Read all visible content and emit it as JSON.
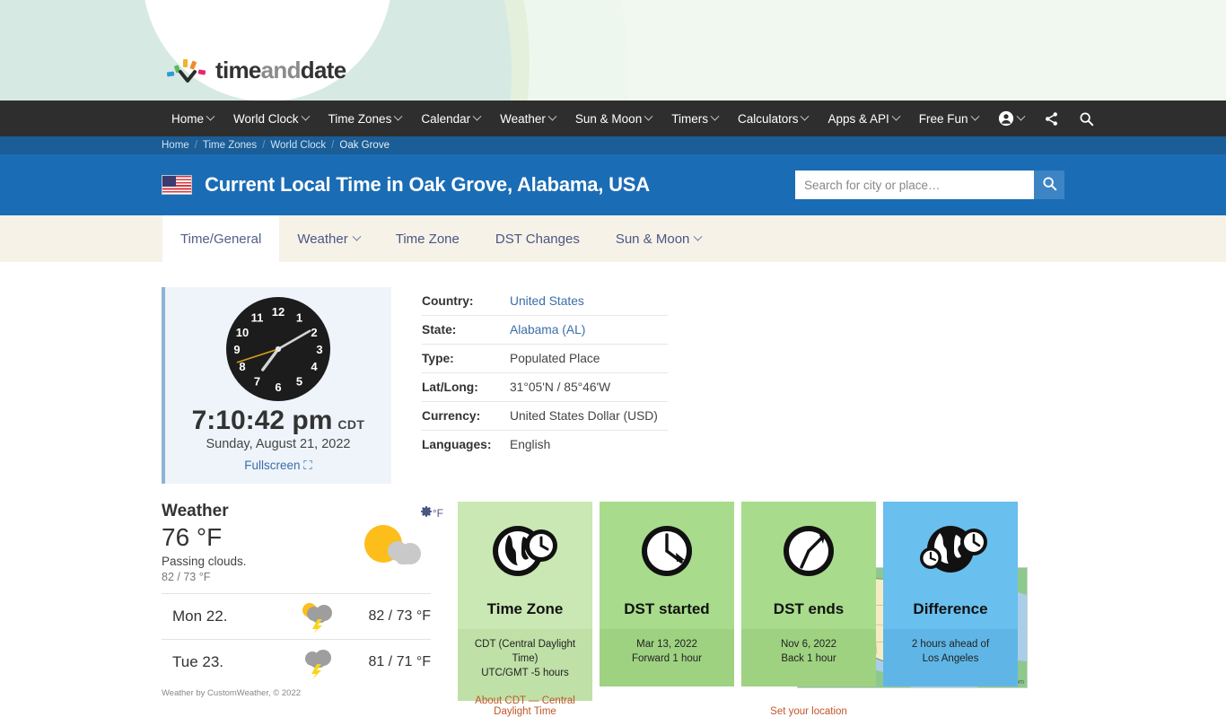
{
  "brand": {
    "name_part1": "time",
    "name_part2": "and",
    "name_part3": "date"
  },
  "nav": {
    "items": [
      {
        "label": "Home",
        "has_caret": true
      },
      {
        "label": "World Clock",
        "has_caret": true
      },
      {
        "label": "Time Zones",
        "has_caret": true
      },
      {
        "label": "Calendar",
        "has_caret": true
      },
      {
        "label": "Weather",
        "has_caret": true
      },
      {
        "label": "Sun & Moon",
        "has_caret": true
      },
      {
        "label": "Timers",
        "has_caret": true
      },
      {
        "label": "Calculators",
        "has_caret": true
      },
      {
        "label": "Apps & API",
        "has_caret": true
      },
      {
        "label": "Free Fun",
        "has_caret": true
      }
    ],
    "account_icon": "user-account-icon",
    "share_icon": "share-icon",
    "search_icon": "search-icon"
  },
  "breadcrumb": [
    "Home",
    "Time Zones",
    "World Clock",
    "Oak Grove"
  ],
  "header": {
    "flag_icon": "usa-flag-icon",
    "title": "Current Local Time in Oak Grove, Alabama, USA",
    "search_placeholder": "Search for city or place…",
    "search_value": "",
    "search_button_icon": "search-icon"
  },
  "tabs": [
    {
      "label": "Time/General",
      "active": true,
      "caret": false
    },
    {
      "label": "Weather",
      "active": false,
      "caret": true
    },
    {
      "label": "Time Zone",
      "active": false,
      "caret": false
    },
    {
      "label": "DST Changes",
      "active": false,
      "caret": false
    },
    {
      "label": "Sun & Moon",
      "active": false,
      "caret": true
    }
  ],
  "clock": {
    "time": "7:10:42 pm",
    "timezone_abbr": "CDT",
    "date": "Sunday, August 21, 2022",
    "fullscreen_label": "Fullscreen",
    "fullscreen_icon": "expand-icon",
    "hours": 7,
    "minutes": 10,
    "seconds": 42,
    "numerals": [
      "12",
      "1",
      "2",
      "3",
      "4",
      "5",
      "6",
      "7",
      "8",
      "9",
      "10",
      "11"
    ]
  },
  "info": {
    "rows": [
      {
        "key": "Country:",
        "value": "United States",
        "link": true
      },
      {
        "key": "State:",
        "value": "Alabama (AL)",
        "link": true
      },
      {
        "key": "Type:",
        "value": "Populated Place",
        "link": false
      },
      {
        "key": "Lat/Long:",
        "value": "31°05'N / 85°46'W",
        "link": false
      },
      {
        "key": "Currency:",
        "value": "United States Dollar (USD)",
        "link": false
      },
      {
        "key": "Languages:",
        "value": "English",
        "link": false
      }
    ]
  },
  "map": {
    "credit": "© timeanddate.com",
    "alt": "map-of-united-states"
  },
  "weather": {
    "title": "Weather",
    "temperature": "76 °F",
    "description": "Passing clouds.",
    "high_low": "82 / 73 °F",
    "unit_toggle": "°F",
    "gear_icon": "gear-icon",
    "current_icon": "sun-behind-cloud-icon",
    "forecast": [
      {
        "day": "Mon 22.",
        "icon": "sun-cloud-thunderstorm-icon",
        "temps": "82 / 73 °F"
      },
      {
        "day": "Tue 23.",
        "icon": "cloud-thunderstorm-icon",
        "temps": "81 / 71 °F"
      }
    ],
    "credit": "Weather by CustomWeather, © 2022"
  },
  "cards": [
    {
      "icon": "globe-clock-icon",
      "title": "Time Zone",
      "line1": "CDT (Central Daylight Time)",
      "line2": "UTC/GMT -5 hours",
      "link": "About CDT — Central Daylight Time",
      "theme": "c-green-light"
    },
    {
      "icon": "clock-forward-icon",
      "title": "DST started",
      "line1": "Mar 13, 2022",
      "line2": "Forward 1 hour",
      "link": "",
      "theme": "c-green"
    },
    {
      "icon": "clock-backward-icon",
      "title": "DST ends",
      "line1": "Nov 6, 2022",
      "line2": "Back 1 hour",
      "link": "Set your location",
      "theme": "c-green"
    },
    {
      "icon": "globe-clocks-difference-icon",
      "title": "Difference",
      "line1": "2 hours ahead of",
      "line2": "Los Angeles",
      "link": "",
      "theme": "c-blue"
    }
  ],
  "colors": {
    "nav_bg": "#2e2e2e",
    "title_bg": "#1a6cb5",
    "breadcrumb_bg": "#1b5d96",
    "tab_bg": "#f7f2e8",
    "link": "#3a6ea8",
    "card_green_light": "#cae8b3",
    "card_green": "#a8dc8c",
    "card_blue": "#69bfee"
  }
}
